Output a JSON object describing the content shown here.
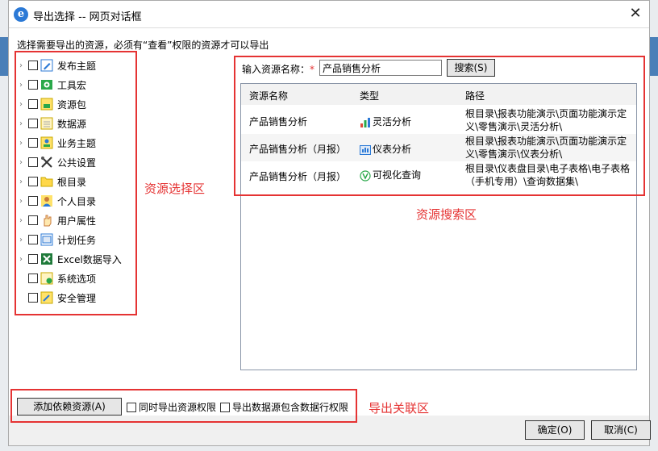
{
  "window": {
    "title": "导出选择 -- 网页对话框",
    "close_glyph": "✕"
  },
  "instruction": "选择需要导出的资源，必须有“查看”权限的资源才可以导出",
  "tree": [
    {
      "label": "发布主题",
      "icon": "publish-icon",
      "has_arrow": true
    },
    {
      "label": "工具宏",
      "icon": "macro-icon",
      "has_arrow": true
    },
    {
      "label": "资源包",
      "icon": "package-icon",
      "has_arrow": true
    },
    {
      "label": "数据源",
      "icon": "datasource-icon",
      "has_arrow": true
    },
    {
      "label": "业务主题",
      "icon": "business-theme-icon",
      "has_arrow": true
    },
    {
      "label": "公共设置",
      "icon": "tools-icon",
      "has_arrow": true
    },
    {
      "label": "根目录",
      "icon": "folder-icon",
      "has_arrow": true
    },
    {
      "label": "个人目录",
      "icon": "person-icon",
      "has_arrow": true
    },
    {
      "label": "用户属性",
      "icon": "hand-icon",
      "has_arrow": true
    },
    {
      "label": "计划任务",
      "icon": "schedule-icon",
      "has_arrow": true
    },
    {
      "label": "Excel数据导入",
      "icon": "excel-icon",
      "has_arrow": true
    },
    {
      "label": "系统选项",
      "icon": "system-options-icon",
      "has_arrow": false
    },
    {
      "label": "安全管理",
      "icon": "security-icon",
      "has_arrow": false
    }
  ],
  "annotations": {
    "left": "资源选择区",
    "right": "资源搜索区",
    "bottom": "导出关联区"
  },
  "search": {
    "label": "输入资源名称：",
    "required_mark": "*",
    "value": "产品销售分析",
    "button": "搜索(S)"
  },
  "results": {
    "headers": {
      "name": "资源名称",
      "type": "类型",
      "path": "路径"
    },
    "rows": [
      {
        "name": "产品销售分析",
        "type": "灵活分析",
        "icon": "flex-analysis-icon",
        "path": "根目录\\报表功能演示\\页面功能演示定义\\零售演示\\灵活分析\\"
      },
      {
        "name": "产品销售分析（月报）",
        "type": "仪表分析",
        "icon": "dashboard-icon",
        "path": "根目录\\报表功能演示\\页面功能演示定义\\零售演示\\仪表分析\\"
      },
      {
        "name": "产品销售分析（月报）",
        "type": "可视化查询",
        "icon": "visual-query-icon",
        "path": "根目录\\仪表盘目录\\电子表格\\电子表格（手机专用）\\查询数据集\\"
      }
    ]
  },
  "bottom": {
    "add_button": "添加依赖资源(A)",
    "check1": "同时导出资源权限",
    "check2": "导出数据源包含数据行权限"
  },
  "footer": {
    "ok": "确定(O)",
    "cancel": "取消(C)"
  },
  "colors": {
    "highlight": "#e53333",
    "accent": "#2b79d6"
  }
}
